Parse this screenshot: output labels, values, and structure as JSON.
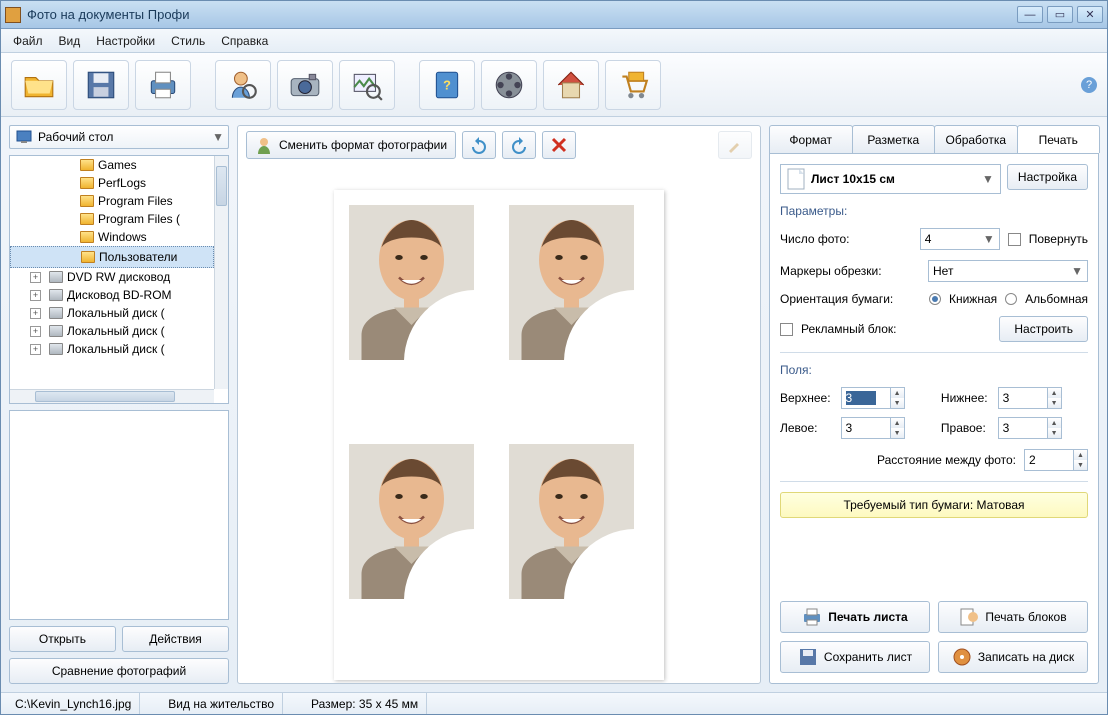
{
  "window": {
    "title": "Фото на документы Профи"
  },
  "menu": {
    "file": "Файл",
    "view": "Вид",
    "settings": "Настройки",
    "style": "Стиль",
    "help": "Справка"
  },
  "left": {
    "root": "Рабочий стол",
    "tree": [
      "Games",
      "PerfLogs",
      "Program Files",
      "Program Files (",
      "Windows",
      "Пользователи"
    ],
    "drives": [
      "DVD RW дисковод",
      "Дисковод BD-ROM",
      "Локальный диск (",
      "Локальный диск (",
      "Локальный диск ("
    ],
    "open": "Открыть",
    "actions": "Действия",
    "compare": "Сравнение фотографий"
  },
  "center": {
    "change_fmt": "Сменить формат фотографии"
  },
  "tabs": {
    "format": "Формат",
    "layout": "Разметка",
    "process": "Обработка",
    "print": "Печать"
  },
  "print": {
    "sheet": "Лист 10x15 см",
    "settings_btn": "Настройка",
    "params_title": "Параметры:",
    "photo_count_lbl": "Число фото:",
    "photo_count": "4",
    "rotate": "Повернуть",
    "crop_lbl": "Маркеры обрезки:",
    "crop_val": "Нет",
    "orient_lbl": "Ориентация бумаги:",
    "orient_book": "Книжная",
    "orient_alb": "Альбомная",
    "ad_lbl": "Рекламный блок:",
    "ad_btn": "Настроить",
    "margins_title": "Поля:",
    "m_top_lbl": "Верхнее:",
    "m_top": "3",
    "m_bot_lbl": "Нижнее:",
    "m_bot": "3",
    "m_left_lbl": "Левое:",
    "m_left": "3",
    "m_right_lbl": "Правое:",
    "m_right": "3",
    "gap_lbl": "Расстояние между фото:",
    "gap": "2",
    "paper_req": "Требуемый тип бумаги: Матовая",
    "a_print": "Печать листа",
    "a_blocks": "Печать блоков",
    "a_save": "Сохранить лист",
    "a_burn": "Записать на диск"
  },
  "status": {
    "file": "C:\\Kevin_Lynch16.jpg",
    "type": "Вид на жительство",
    "size": "Размер: 35 x 45 мм"
  }
}
